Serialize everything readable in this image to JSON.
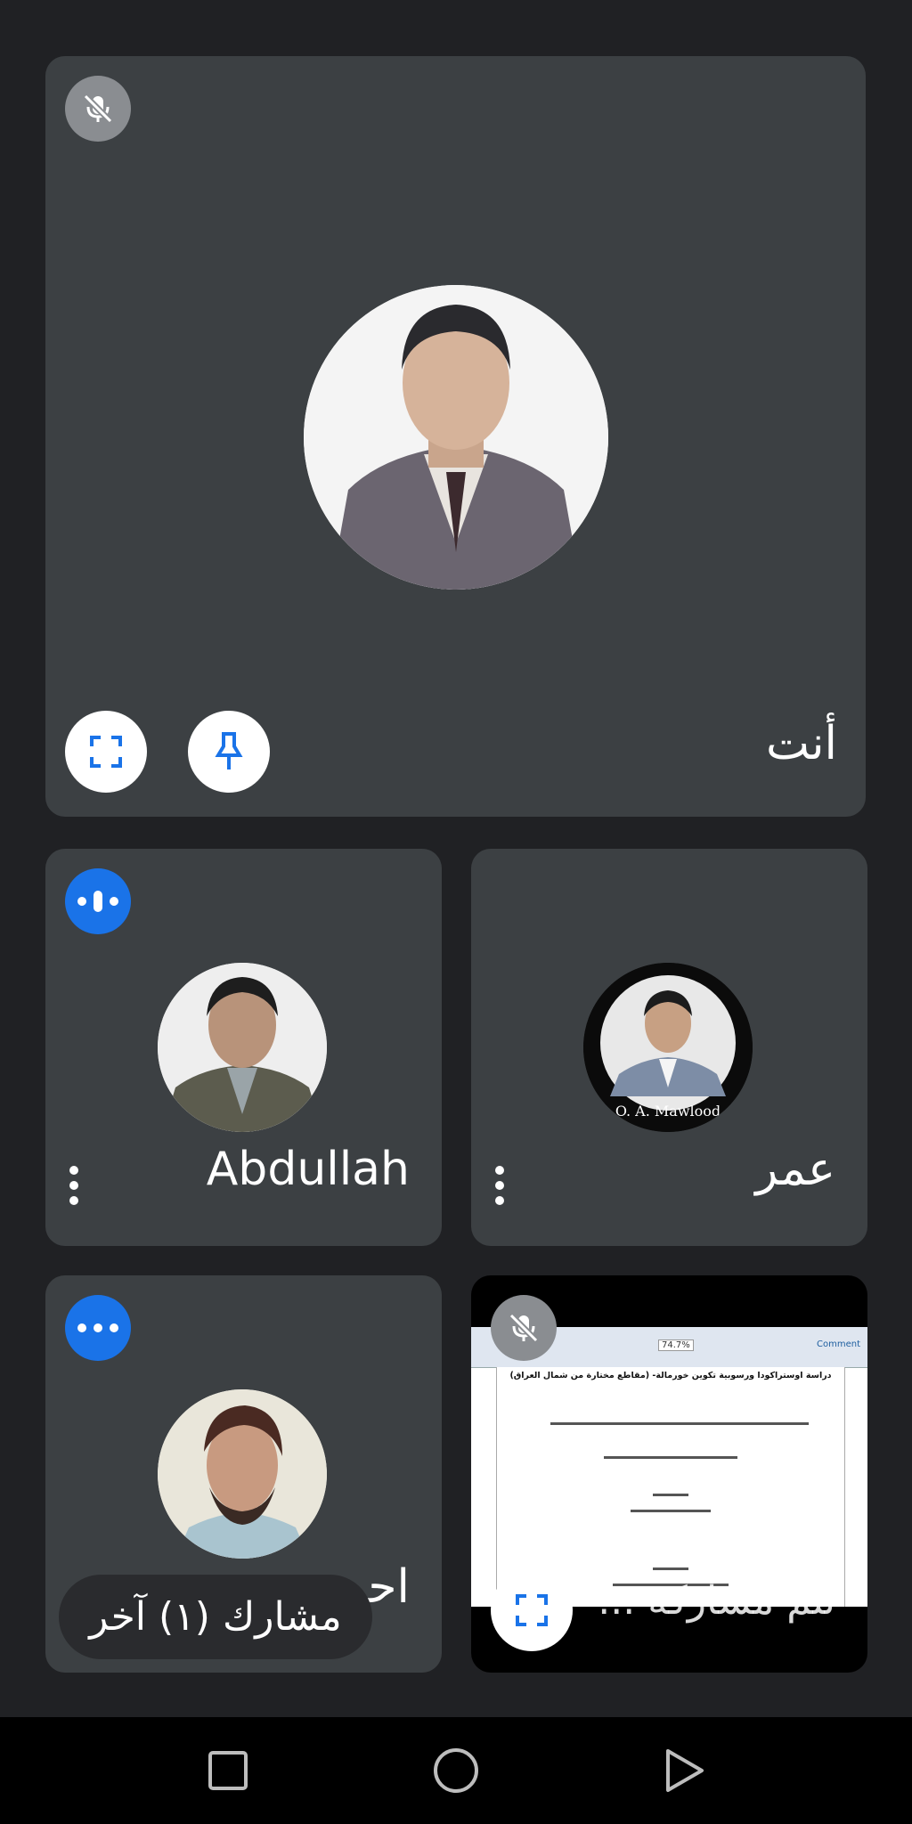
{
  "main_tile": {
    "name": "أنت",
    "mic_status": "muted",
    "icons": [
      "mic-off-icon",
      "fullscreen-icon",
      "pin-icon"
    ]
  },
  "participants": [
    {
      "name": "Abdullah",
      "status": "speaking",
      "icon": "speaking-icon"
    },
    {
      "name": "عمر",
      "status": "idle",
      "avatar_caption": "O. A. Mawlood"
    },
    {
      "name": "احمد",
      "status": "speaking",
      "icon": "speaking-icon"
    }
  ],
  "screen_share": {
    "label": "تتم مشاركة ...",
    "mic_status": "muted",
    "doc_title": "دراسة اوستراكودا ورسوبية تكوين خورمالة- (مقاطع مختارة من شمال العراق)",
    "zoom": "74.7%",
    "toolbar_button": "Comment"
  },
  "overflow_chip": {
    "label": "مشارك (١) آخر"
  },
  "nav": [
    "recents-icon",
    "home-icon",
    "back-icon"
  ],
  "colors": {
    "tile": "#3c4043",
    "background": "#202124",
    "accent": "#1a73e8"
  }
}
